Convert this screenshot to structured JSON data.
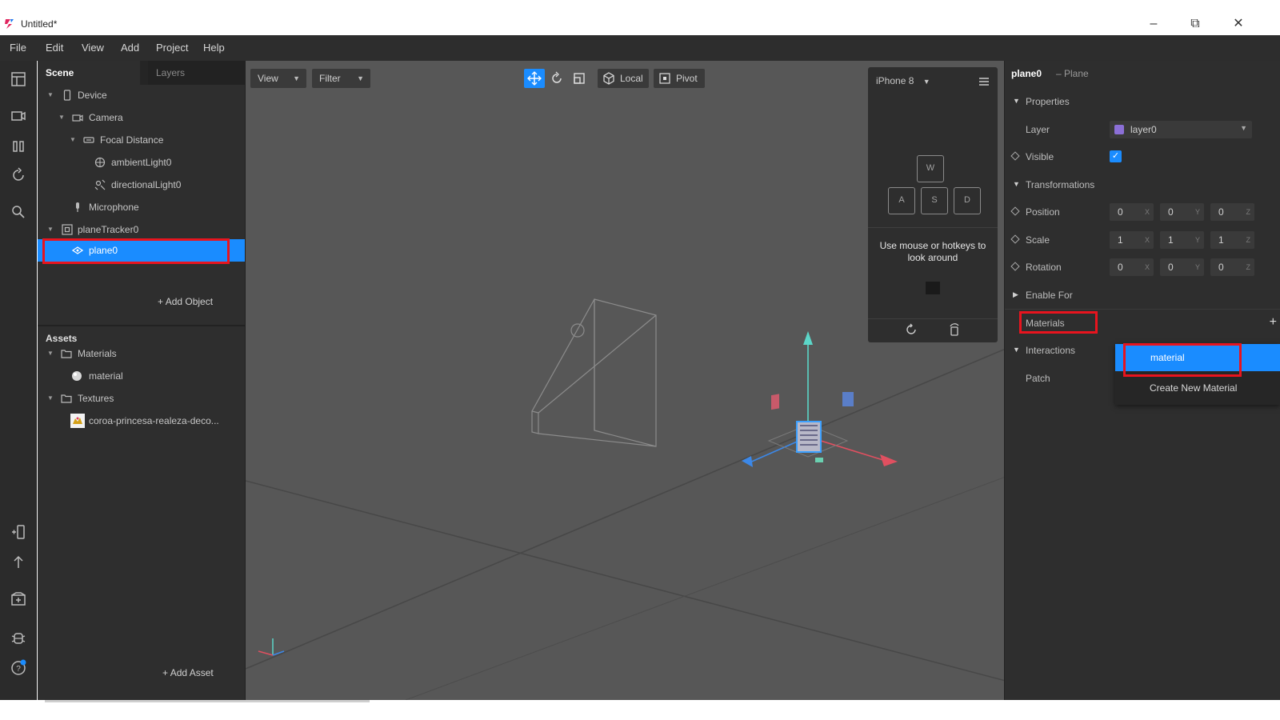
{
  "window": {
    "title": "Untitled*",
    "minimize": "–",
    "maximize": "⧉",
    "close": "✕"
  },
  "menu": [
    "File",
    "Edit",
    "View",
    "Add",
    "Project",
    "Help"
  ],
  "scene_panel": {
    "tabs": {
      "scene": "Scene",
      "layers": "Layers"
    },
    "tree": [
      {
        "label": "Device",
        "icon": "device-icon"
      },
      {
        "label": "Camera",
        "icon": "camera-icon"
      },
      {
        "label": "Focal Distance",
        "icon": "focal-distance-icon"
      },
      {
        "label": "ambientLight0",
        "icon": "ambient-light-icon"
      },
      {
        "label": "directionalLight0",
        "icon": "directional-light-icon"
      },
      {
        "label": "Microphone",
        "icon": "microphone-icon"
      },
      {
        "label": "planeTracker0",
        "icon": "plane-tracker-icon"
      },
      {
        "label": "plane0",
        "icon": "plane-icon",
        "selected": true
      }
    ],
    "add_object": "Add Object"
  },
  "assets_panel": {
    "title": "Assets",
    "tree": [
      {
        "label": "Materials",
        "icon": "folder-icon"
      },
      {
        "label": "material",
        "icon": "material-sphere-icon"
      },
      {
        "label": "Textures",
        "icon": "folder-icon"
      },
      {
        "label": "coroa-princesa-realeza-deco...",
        "icon": "texture-thumbnail-icon"
      }
    ],
    "add_asset": "Add Asset"
  },
  "viewport": {
    "view_dropdown": "View",
    "filter_dropdown": "Filter",
    "local_button": "Local",
    "pivot_button": "Pivot",
    "simulator": {
      "device": "iPhone 8",
      "keys": [
        "W",
        "A",
        "S",
        "D"
      ],
      "hint": "Use mouse or hotkeys to look around"
    }
  },
  "inspector": {
    "object_name": "plane0",
    "object_type": "– Plane",
    "properties_header": "Properties",
    "layer_label": "Layer",
    "layer_value": "layer0",
    "layer_color": "#8b6fd6",
    "visible_label": "Visible",
    "visible_checked": true,
    "transformations_header": "Transformations",
    "position": {
      "label": "Position",
      "values": [
        "0",
        "0",
        "0"
      ]
    },
    "scale": {
      "label": "Scale",
      "values": [
        "1",
        "1",
        "1"
      ]
    },
    "rotation": {
      "label": "Rotation",
      "values": [
        "0",
        "0",
        "0"
      ]
    },
    "axes": [
      "X",
      "Y",
      "Z"
    ],
    "enable_for_header": "Enable For",
    "materials_label": "Materials",
    "add_plus": "+",
    "interactions_header": "Interactions",
    "patch_label": "Patch",
    "material_dropdown": {
      "options": [
        "material",
        "Create New Material"
      ],
      "selected": "material"
    }
  },
  "colors": {
    "accent": "#1a8cff",
    "highlight": "#e8141e",
    "panel": "#2e2e2e",
    "viewport": "#575757"
  }
}
